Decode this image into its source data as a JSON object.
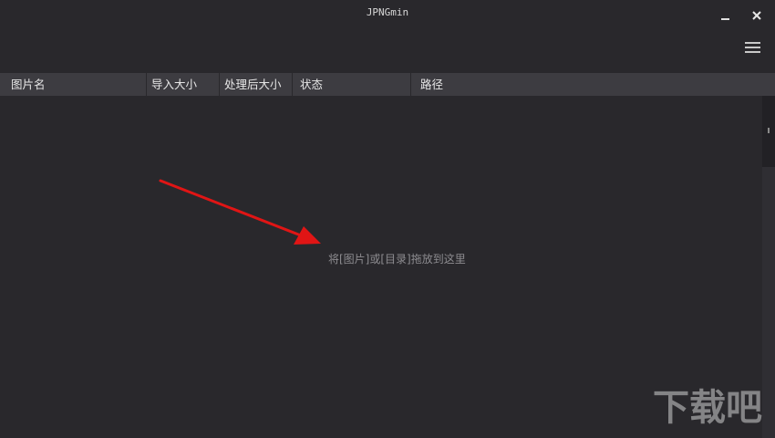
{
  "window": {
    "title": "JPNGmin",
    "controls": {
      "minimize_icon": "minimize-icon",
      "close_icon": "close-icon",
      "menu_icon": "hamburger-menu-icon"
    }
  },
  "table": {
    "columns": [
      "图片名",
      "导入大小",
      "处理后大小",
      "状态",
      "路径"
    ],
    "rows": []
  },
  "drop_area": {
    "hint": "将[图片]或[目录]拖放到这里"
  },
  "annotation": {
    "arrow_color": "#e01515"
  },
  "watermark": {
    "text": "下载吧"
  },
  "colors": {
    "background": "#29282c",
    "header": "#3d3c41",
    "text": "#e6e6e6",
    "hint": "#8d8c90"
  }
}
